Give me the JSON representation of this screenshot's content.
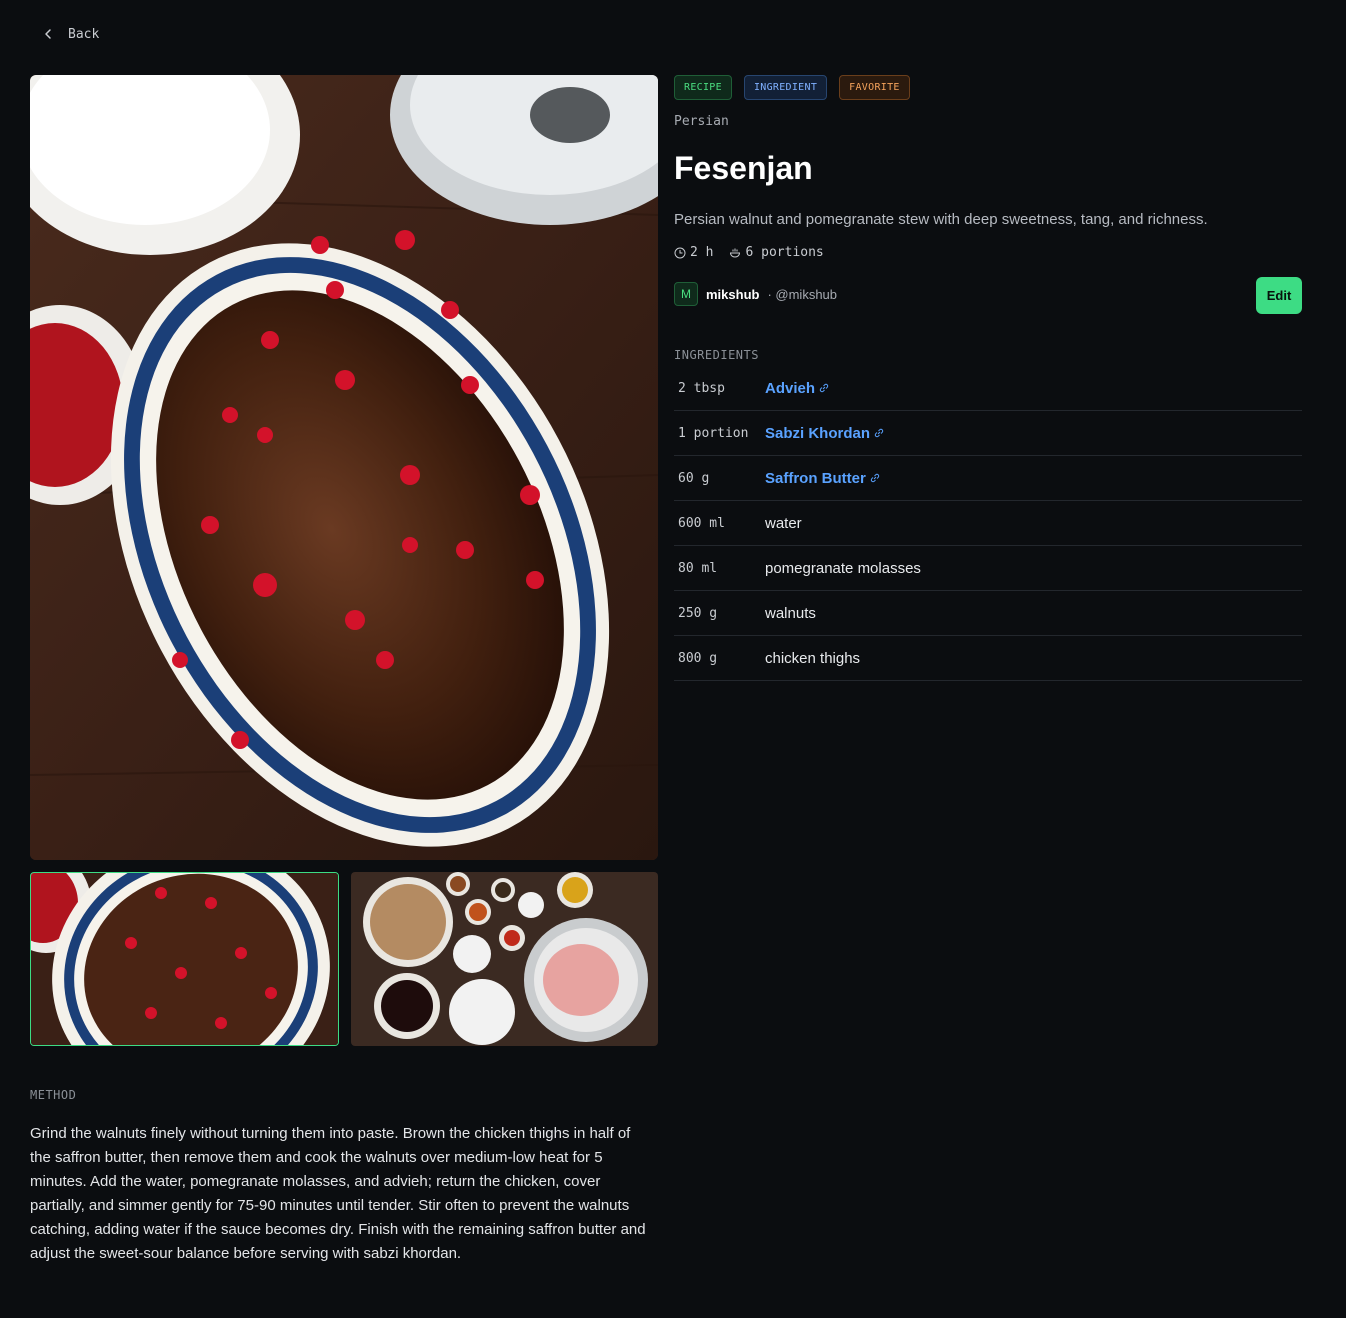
{
  "nav": {
    "back_label": "Back"
  },
  "tags": [
    "RECIPE",
    "INGREDIENT",
    "FAVORITE"
  ],
  "recipe": {
    "cuisine": "Persian",
    "title": "Fesenjan",
    "description": "Persian walnut and pomegranate stew with deep sweetness, tang, and richness.",
    "time": "2 h",
    "portions": "6 portions"
  },
  "author": {
    "initial": "M",
    "name": "mikshub",
    "handle": "· @mikshub"
  },
  "actions": {
    "edit_label": "Edit"
  },
  "ingredients": {
    "heading": "INGREDIENTS",
    "items": [
      {
        "qty": "2 tbsp",
        "name": "Advieh",
        "linked": true
      },
      {
        "qty": "1 portion",
        "name": "Sabzi Khordan",
        "linked": true
      },
      {
        "qty": "60 g",
        "name": "Saffron Butter",
        "linked": true
      },
      {
        "qty": "600 ml",
        "name": "water",
        "linked": false
      },
      {
        "qty": "80 ml",
        "name": "pomegranate molasses",
        "linked": false
      },
      {
        "qty": "250 g",
        "name": "walnuts",
        "linked": false
      },
      {
        "qty": "800 g",
        "name": "chicken thighs",
        "linked": false
      }
    ]
  },
  "method": {
    "heading": "METHOD",
    "text": "Grind the walnuts finely without turning them into paste. Brown the chicken thighs in half of the saffron butter, then remove them and cook the walnuts over medium-low heat for 5 minutes. Add the water, pomegranate molasses, and advieh; return the chicken, cover partially, and simmer gently for 75-90 minutes until tender. Stir often to prevent the walnuts catching, adding water if the sauce becomes dry. Finish with the remaining saffron butter and adjust the sweet-sour balance before serving with sabzi khordan."
  },
  "colors": {
    "accent": "#3ddc84",
    "link": "#5aa2ff",
    "background": "#0b0d10"
  }
}
